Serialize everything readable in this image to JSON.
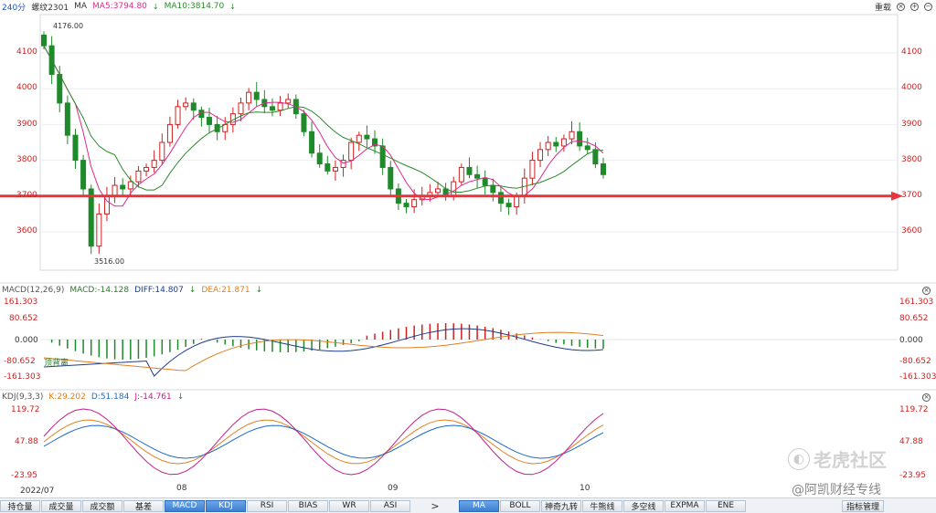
{
  "header": {
    "period": "240分",
    "symbol": "螺纹2301",
    "indicator": "MA",
    "ma5": "MA5:3794.80",
    "ma10": "MA10:3814.70",
    "down_arrow": "↓",
    "right_label": "重载"
  },
  "price_axis": {
    "ticks": [
      "4100",
      "4000",
      "3900",
      "3800",
      "3700",
      "3600"
    ],
    "high_marker": "4176.00",
    "low_marker": "3516.00"
  },
  "macd_panel": {
    "title": "MACD(12,26,9)",
    "macd": "MACD:-14.128",
    "diff": "DIFF:14.807",
    "dea": "DEA:21.871",
    "ticks": [
      "161.303",
      "80.652",
      "0.000",
      "-80.652",
      "-161.303"
    ],
    "annotation": "顶背离"
  },
  "kdj_panel": {
    "title": "KDJ(9,3,3)",
    "k": "K:29.202",
    "d": "D:51.184",
    "j": "J:-14.761",
    "ticks": [
      "119.72",
      "47.88",
      "-23.95"
    ]
  },
  "x_axis": {
    "labels": [
      "2022/07",
      "08",
      "09",
      "10"
    ]
  },
  "bottom_tabs_left": [
    "持仓量",
    "成交量",
    "成交额",
    "基差",
    "MACD",
    "KDJ",
    "RSI",
    "BIAS",
    "WR",
    "ASI"
  ],
  "bottom_tabs_right": [
    "MA",
    "BOLL",
    "神奇九转",
    "牛熊线",
    "多空线",
    "EXPMA",
    "ENE"
  ],
  "active_tabs": [
    "MACD",
    "KDJ",
    "MA"
  ],
  "more_tab": ">",
  "manage_button": "指标管理",
  "watermark": {
    "line1": "老虎社区",
    "line2": "@阿凯财经专线"
  },
  "colors": {
    "up": "#d0201f",
    "down": "#1f8a2a",
    "ma5": "#e0288a",
    "ma10": "#2a8a2a",
    "arrow": "#e8343a",
    "axis_text": "#c22222"
  },
  "chart_data": {
    "type": "candlestick",
    "ylim": [
      3516,
      4176
    ],
    "support_level": 3700,
    "closes": [
      4120,
      4040,
      3960,
      3870,
      3800,
      3720,
      3560,
      3650,
      3700,
      3730,
      3720,
      3740,
      3770,
      3780,
      3800,
      3850,
      3900,
      3950,
      3960,
      3940,
      3920,
      3900,
      3880,
      3900,
      3930,
      3960,
      3990,
      3970,
      3950,
      3940,
      3960,
      3970,
      3930,
      3880,
      3820,
      3790,
      3770,
      3780,
      3800,
      3850,
      3870,
      3860,
      3840,
      3780,
      3720,
      3680,
      3670,
      3690,
      3700,
      3710,
      3720,
      3700,
      3740,
      3780,
      3760,
      3750,
      3730,
      3710,
      3680,
      3670,
      3700,
      3750,
      3800,
      3830,
      3850,
      3840,
      3860,
      3880,
      3840,
      3830,
      3790,
      3760
    ]
  }
}
